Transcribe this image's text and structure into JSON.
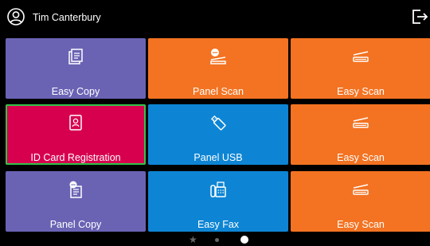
{
  "header": {
    "user_name": "Tim Canterbury"
  },
  "tiles": [
    {
      "label": "Easy Copy",
      "color": "#6a63b4",
      "icon": "copy-icon"
    },
    {
      "label": "Panel Scan",
      "color": "#f37322",
      "icon": "scan-chat-icon"
    },
    {
      "label": "Easy Scan",
      "color": "#f37322",
      "icon": "scanner-icon"
    },
    {
      "label": "ID Card Registration",
      "color": "#d7004f",
      "icon": "id-card-icon",
      "selected": true
    },
    {
      "label": "Panel USB",
      "color": "#0d85d4",
      "icon": "usb-icon"
    },
    {
      "label": "Easy Scan",
      "color": "#f37322",
      "icon": "scanner-icon"
    },
    {
      "label": "Panel Copy",
      "color": "#6a63b4",
      "icon": "copy-chat-icon"
    },
    {
      "label": "Easy Fax",
      "color": "#0d85d4",
      "icon": "fax-icon"
    },
    {
      "label": "Easy Scan",
      "color": "#f37322",
      "icon": "scanner-icon"
    }
  ],
  "pager": {
    "pages": 3,
    "current_page": 3
  }
}
